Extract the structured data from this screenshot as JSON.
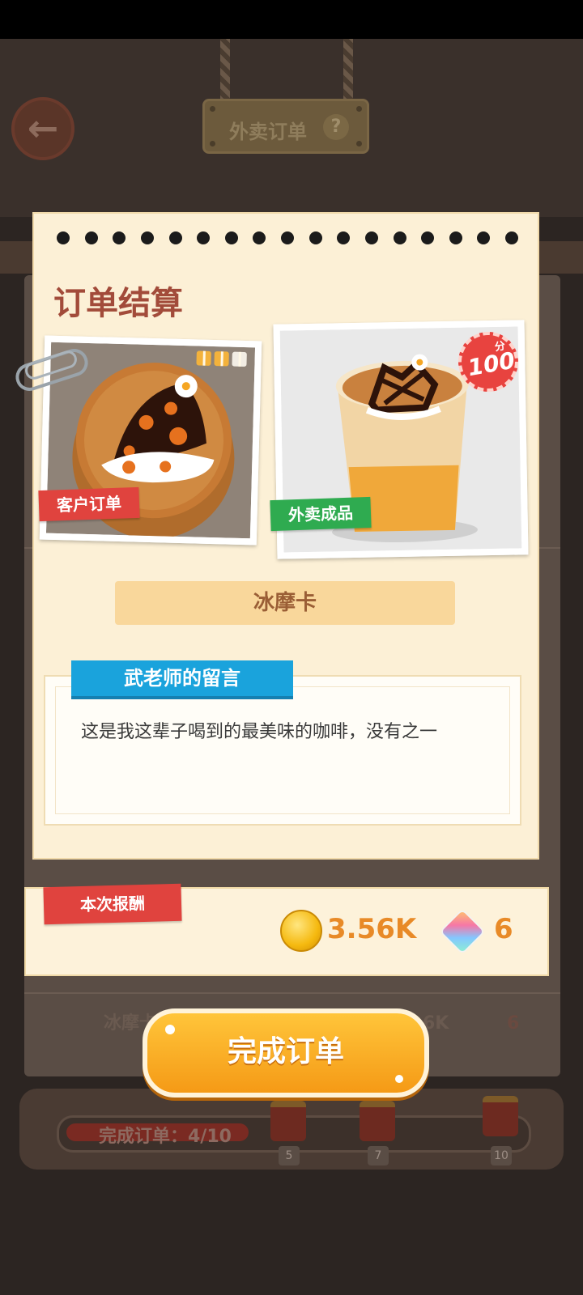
{
  "header": {
    "title": "外卖订单",
    "help": "?",
    "back": "←"
  },
  "dialog": {
    "heading": "订单结算",
    "customer_tag": "客户订单",
    "product_tag": "外卖成品",
    "score": {
      "unit": "分",
      "value": "100"
    },
    "drink_name": "冰摩卡",
    "message": {
      "title": "武老师的留言",
      "text": "这是我这辈子喝到的最美味的咖啡，没有之一"
    }
  },
  "reward": {
    "label": "本次报酬",
    "coins": "3.56K",
    "gems": "6"
  },
  "complete_button": "完成订单",
  "background": {
    "progress_text": "完成订单：4/10",
    "milestones": [
      "5",
      "7",
      "10"
    ],
    "row_name": "冰摩卡",
    "row_tail": "6K",
    "row_gems": "6"
  },
  "icons": [
    "back-arrow-icon",
    "help-icon",
    "paperclip-icon",
    "gift-icon",
    "coin-icon",
    "gem-icon"
  ],
  "colors": {
    "accent_red": "#e0433e",
    "accent_green": "#2fab50",
    "accent_blue": "#1aa3dc",
    "button_orange": "#f59a16",
    "heading_red": "#a24b3a"
  }
}
